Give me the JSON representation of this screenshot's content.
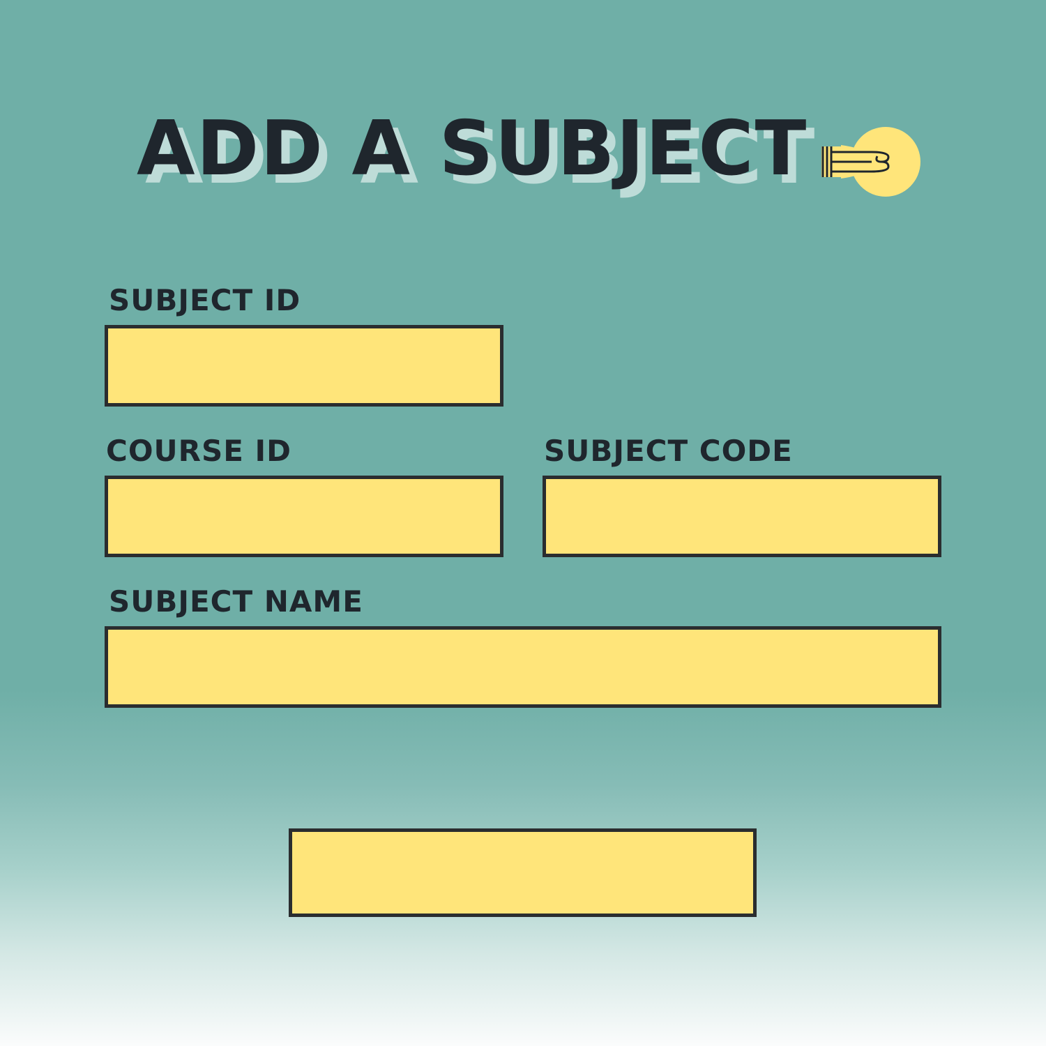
{
  "form": {
    "title": "ADD A SUBJECT",
    "icon": "lightbulb-icon",
    "fields": {
      "subject_id": {
        "label": "SUBJECT ID",
        "value": "",
        "placeholder": ""
      },
      "course_id": {
        "label": "COURSE ID",
        "value": "",
        "placeholder": ""
      },
      "subject_code": {
        "label": "SUBJECT CODE",
        "value": "",
        "placeholder": ""
      },
      "subject_name": {
        "label": "SUBJECT NAME",
        "value": "",
        "placeholder": ""
      }
    },
    "submit": {
      "label": ""
    }
  },
  "colors": {
    "background": "#6fafa7",
    "field_fill": "#ffe57a",
    "field_border": "#2a2d2f",
    "text": "#1f262d",
    "title_shadow": "#bedcd8",
    "bulb": "#ffe57a"
  }
}
